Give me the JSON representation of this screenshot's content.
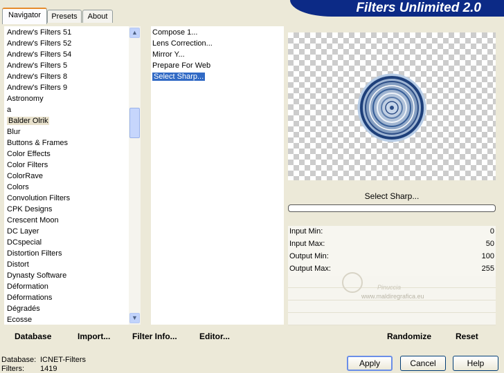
{
  "tabs": [
    {
      "label": "Navigator"
    },
    {
      "label": "Presets"
    },
    {
      "label": "About"
    }
  ],
  "banner": {
    "title": "Filters Unlimited 2.0"
  },
  "categories": [
    "Andrew's Filters 51",
    "Andrew's Filters 52",
    "Andrew's Filters 54",
    "Andrew's Filters 5",
    "Andrew's Filters 8",
    "Andrew's Filters 9",
    "Astronomy",
    "a",
    "Balder Olrik",
    "Blur",
    "Buttons & Frames",
    "Color Effects",
    "Color Filters",
    "ColorRave",
    "Colors",
    "Convolution Filters",
    "CPK Designs",
    "Crescent Moon",
    "DC Layer",
    "DCspecial",
    "Distortion Filters",
    "Distort",
    "Dynasty Software",
    "Déformation",
    "Déformations",
    "Dégradés",
    "Ecosse"
  ],
  "selected_category": "Balder Olrik",
  "filters": [
    "Compose 1...",
    "Lens Correction...",
    "Mirror Y...",
    "Prepare For Web",
    "Select Sharp..."
  ],
  "selected_filter": "Select Sharp...",
  "preview": {
    "filter_name": "Select Sharp...",
    "watermark": "www.maldiregrafica.eu",
    "watermark_name": "Pinuccia"
  },
  "params": [
    {
      "label": "Input Min:",
      "value": "0"
    },
    {
      "label": "Input Max:",
      "value": "50"
    },
    {
      "label": "Output Min:",
      "value": "100"
    },
    {
      "label": "Output Max:",
      "value": "255"
    }
  ],
  "toolbar": {
    "database": "Database",
    "import": "Import...",
    "filter_info": "Filter Info...",
    "editor": "Editor...",
    "randomize": "Randomize",
    "reset": "Reset"
  },
  "status": {
    "database_label": "Database:",
    "database_value": "ICNET-Filters",
    "filters_label": "Filters:",
    "filters_value": "1419"
  },
  "buttons": {
    "apply": "Apply",
    "cancel": "Cancel",
    "help": "Help"
  },
  "colors": {
    "banner": "#0c2a86",
    "selection": "#316ac5",
    "window_bg": "#ece9d8"
  }
}
